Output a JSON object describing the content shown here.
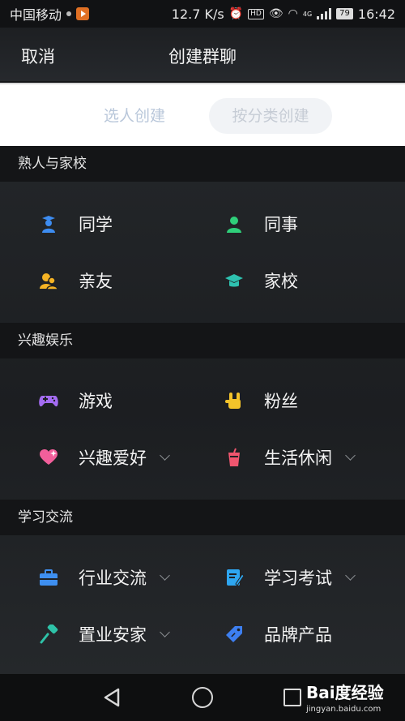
{
  "status_bar": {
    "carrier": "中国移动",
    "speed": "12.7 K/s",
    "network": "4G",
    "hd": "HD",
    "battery": "79",
    "time": "16:42"
  },
  "header": {
    "cancel": "取消",
    "title": "创建群聊"
  },
  "tabs": [
    {
      "label": "选人创建"
    },
    {
      "label": "按分类创建"
    }
  ],
  "sections": [
    {
      "title": "熟人与家校",
      "items": [
        {
          "label": "同学",
          "icon": "graduate-icon",
          "color": "#3d8cf0"
        },
        {
          "label": "同事",
          "icon": "colleague-icon",
          "color": "#2fcf7a"
        },
        {
          "label": "亲友",
          "icon": "family-icon",
          "color": "#f5b324"
        },
        {
          "label": "家校",
          "icon": "school-cap-icon",
          "color": "#2ec2b0"
        }
      ]
    },
    {
      "title": "兴趣娱乐",
      "items": [
        {
          "label": "游戏",
          "icon": "gamepad-icon",
          "color": "#a46cf2"
        },
        {
          "label": "粉丝",
          "icon": "rock-hand-icon",
          "color": "#f3c32a"
        },
        {
          "label": "兴趣爱好",
          "icon": "heart-icon",
          "color": "#f25f9b"
        },
        {
          "label": "生活休闲",
          "icon": "drink-icon",
          "color": "#f0566f"
        }
      ]
    },
    {
      "title": "学习交流",
      "items": [
        {
          "label": "行业交流",
          "icon": "briefcase-icon",
          "color": "#3e8ff0"
        },
        {
          "label": "学习考试",
          "icon": "exam-icon",
          "color": "#2ea6f0"
        },
        {
          "label": "置业安家",
          "icon": "paint-roller-icon",
          "color": "#2ec2a8"
        },
        {
          "label": "品牌产品",
          "icon": "tag-icon",
          "color": "#3d7ff0"
        }
      ]
    }
  ],
  "watermark": {
    "brand": "Bai度经验",
    "url": "jingyan.baidu.com"
  }
}
